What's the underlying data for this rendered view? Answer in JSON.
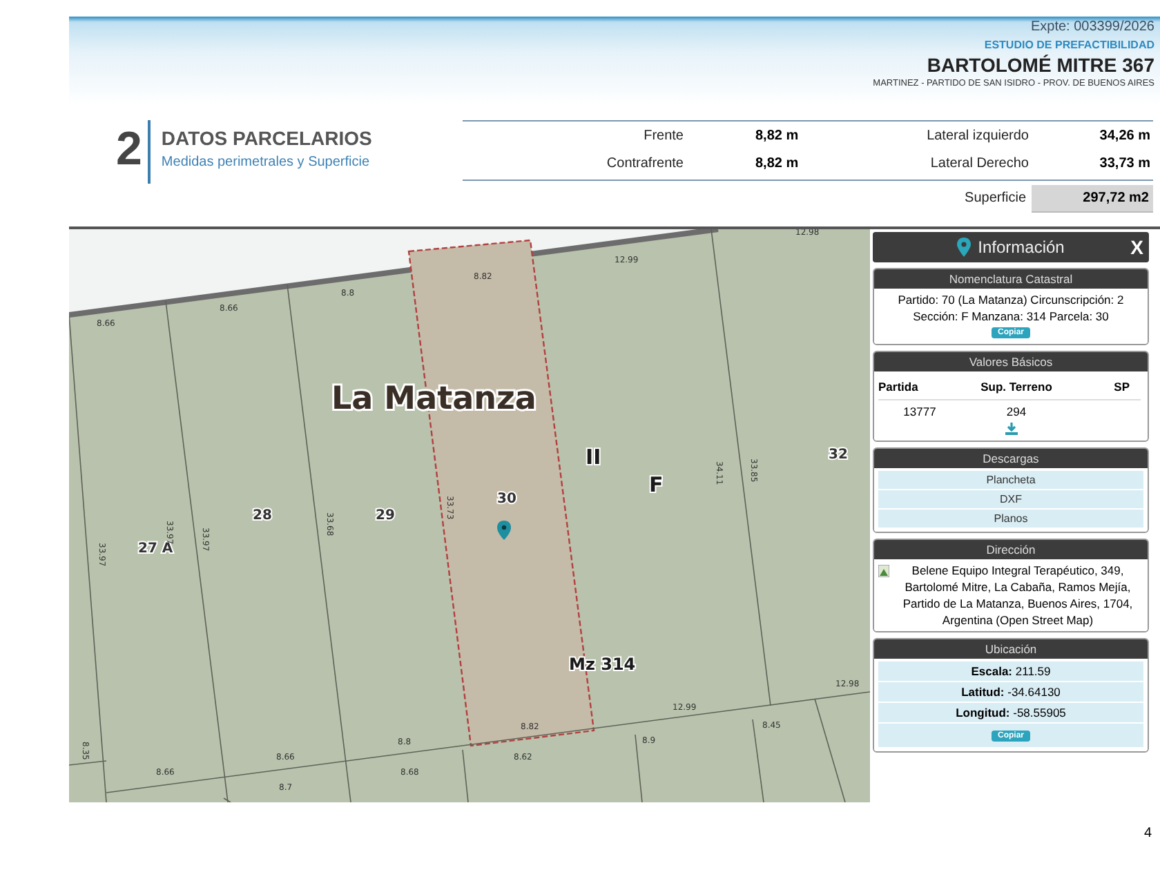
{
  "header": {
    "expediente": "Expte: 003399/2026",
    "study": "ESTUDIO DE PREFACTIBILIDAD",
    "address": "BARTOLOMÉ MITRE 367",
    "location": "MARTINEZ - PARTIDO DE SAN ISIDRO - PROV. DE  BUENOS AIRES"
  },
  "section": {
    "number": "2",
    "title": "DATOS PARCELARIOS",
    "subtitle": "Medidas perimetrales y Superficie"
  },
  "measures": [
    {
      "label": "Frente",
      "value": "8,82 m"
    },
    {
      "label": "Lateral izquierdo",
      "value": "34,26 m"
    },
    {
      "label": "Contrafrente",
      "value": "8,82 m"
    },
    {
      "label": "Lateral Derecho",
      "value": "33,73 m"
    }
  ],
  "surface": {
    "label": "Superficie",
    "value": "297,72 m2"
  },
  "map": {
    "labels": [
      {
        "kind": "place",
        "text": "La Matanza"
      },
      {
        "kind": "zone",
        "text": "II"
      },
      {
        "kind": "zone",
        "text": "F"
      },
      {
        "kind": "parcel",
        "text": "30"
      },
      {
        "kind": "parcel",
        "text": "29"
      },
      {
        "kind": "parcel",
        "text": "28"
      },
      {
        "kind": "parcel",
        "text": "27 A"
      },
      {
        "kind": "parcel",
        "text": "32"
      },
      {
        "kind": "block",
        "text": "Mz 314"
      },
      {
        "kind": "measure",
        "text": "8.82"
      },
      {
        "kind": "measure",
        "text": "12.99"
      },
      {
        "kind": "measure",
        "text": "12.98"
      },
      {
        "kind": "measure",
        "text": "8.8"
      },
      {
        "kind": "measure",
        "text": "8.66"
      },
      {
        "kind": "measure",
        "text": "8.66"
      },
      {
        "kind": "measure",
        "text": "33.73"
      },
      {
        "kind": "measure",
        "text": "33.68"
      },
      {
        "kind": "measure",
        "text": "33.97"
      },
      {
        "kind": "measure",
        "text": "33.97"
      },
      {
        "kind": "measure",
        "text": "33.97"
      },
      {
        "kind": "measure",
        "text": "34.11"
      },
      {
        "kind": "measure",
        "text": "33.85"
      },
      {
        "kind": "measure",
        "text": "8.82"
      },
      {
        "kind": "measure",
        "text": "12.99"
      },
      {
        "kind": "measure",
        "text": "12.98"
      },
      {
        "kind": "measure",
        "text": "8.8"
      },
      {
        "kind": "measure",
        "text": "8.66"
      },
      {
        "kind": "measure",
        "text": "8.66"
      },
      {
        "kind": "measure",
        "text": "8.62"
      },
      {
        "kind": "measure",
        "text": "8.9"
      },
      {
        "kind": "measure",
        "text": "8.45"
      },
      {
        "kind": "measure",
        "text": "8.7"
      },
      {
        "kind": "measure",
        "text": "8.68"
      },
      {
        "kind": "measure",
        "text": "8.35"
      }
    ]
  },
  "info_panel": {
    "title": "Información",
    "close": "X",
    "sections": [
      {
        "kind": "text",
        "title": "Nomenclatura Catastral",
        "lines": [
          "Partido: 70 (La Matanza) Circunscripción: 2",
          "Sección: F Manzana: 314 Parcela: 30"
        ],
        "button": "Copiar"
      },
      {
        "kind": "table",
        "title": "Valores Básicos",
        "columns": [
          "Partida",
          "Sup. Terreno",
          "SP"
        ],
        "row": [
          "13777",
          "294"
        ]
      },
      {
        "kind": "links",
        "title": "Descargas",
        "items": [
          "Plancheta",
          "DXF",
          "Planos"
        ]
      },
      {
        "kind": "address",
        "title": "Dirección",
        "text": "Belene Equipo Integral Terapéutico, 349, Bartolomé Mitre, La Cabaña, Ramos Mejía, Partido de La Matanza, Buenos Aires, 1704, Argentina (Open Street Map)"
      },
      {
        "kind": "fields",
        "title": "Ubicación",
        "fields": [
          {
            "label": "Escala:",
            "value": "211.59"
          },
          {
            "label": "Latitud:",
            "value": "-34.64130"
          },
          {
            "label": "Longitud:",
            "value": "-58.55905"
          }
        ],
        "button": "Copiar"
      }
    ]
  },
  "page_number": "4"
}
